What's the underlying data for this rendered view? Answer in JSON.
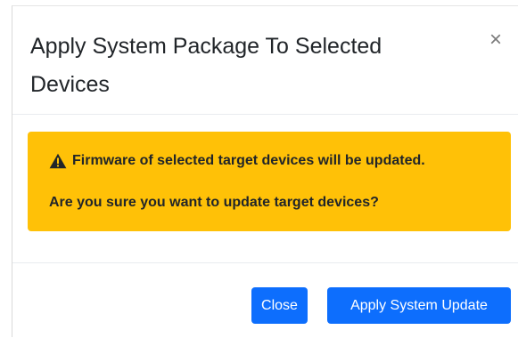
{
  "dialog": {
    "title": "Apply System Package To Selected Devices",
    "close_icon_glyph": "×",
    "close_icon": "close-icon"
  },
  "alert": {
    "icon": "warning-triangle-icon",
    "background_color": "#ffc107",
    "message_line1": "Firmware of selected target devices will be updated.",
    "message_line2": "Are you sure you want to update target devices?"
  },
  "footer": {
    "close_label": "Close",
    "apply_label": "Apply System Update",
    "button_color": "#0d6efd"
  }
}
